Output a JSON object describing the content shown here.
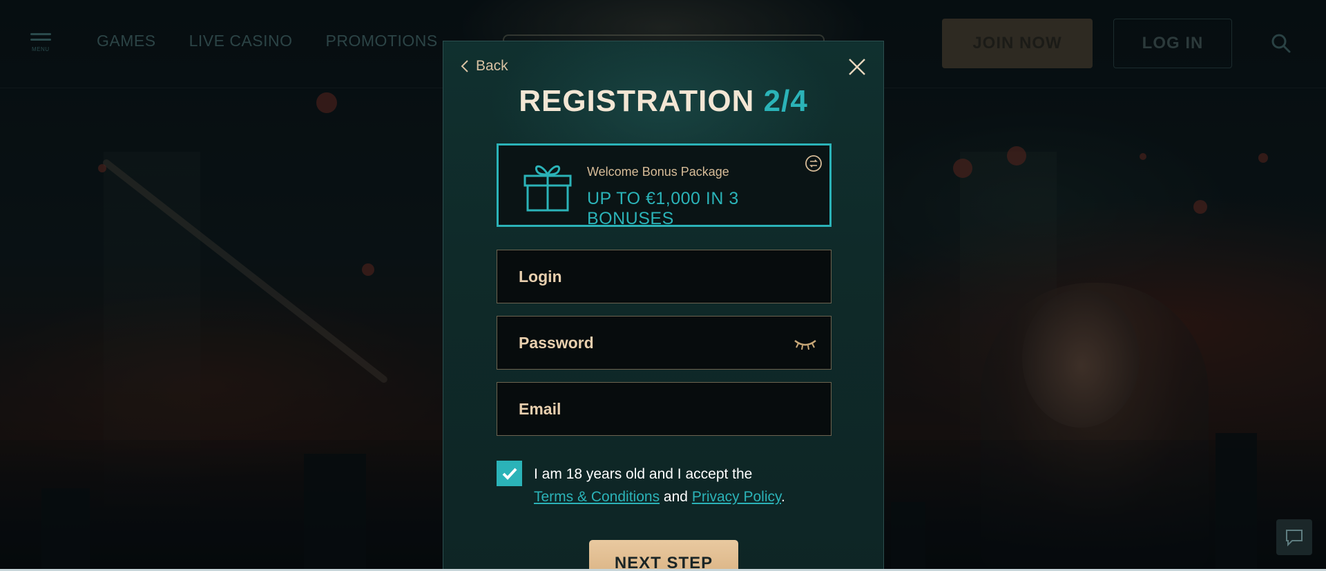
{
  "header": {
    "menu_label": "MENU",
    "nav": [
      {
        "label": "GAMES"
      },
      {
        "label": "LIVE CASINO"
      },
      {
        "label": "PROMOTIONS"
      }
    ],
    "join_label": "JOIN NOW",
    "login_label": "LOG IN",
    "icons": {
      "menu": "hamburger-icon",
      "search": "search-icon"
    }
  },
  "modal": {
    "back_label": "Back",
    "title_main": "REGISTRATION",
    "title_step": "2/4",
    "bonus": {
      "label": "Welcome Bonus Package",
      "amount": "UP TO €1,000 IN 3 BONUSES",
      "icons": {
        "gift": "gift-icon",
        "switch": "swap-icon"
      }
    },
    "fields": {
      "login_placeholder": "Login",
      "password_placeholder": "Password",
      "email_placeholder": "Email"
    },
    "terms": {
      "checked": true,
      "text_before": "I am 18 years old and I accept the",
      "terms_link": "Terms & Conditions",
      "and": "and",
      "privacy_link": "Privacy Policy",
      "period": "."
    },
    "next_label": "NEXT STEP"
  },
  "colors": {
    "accent_teal": "#2bb3b8",
    "gold": "#d6ad7c",
    "cream": "#f3e6d4"
  }
}
